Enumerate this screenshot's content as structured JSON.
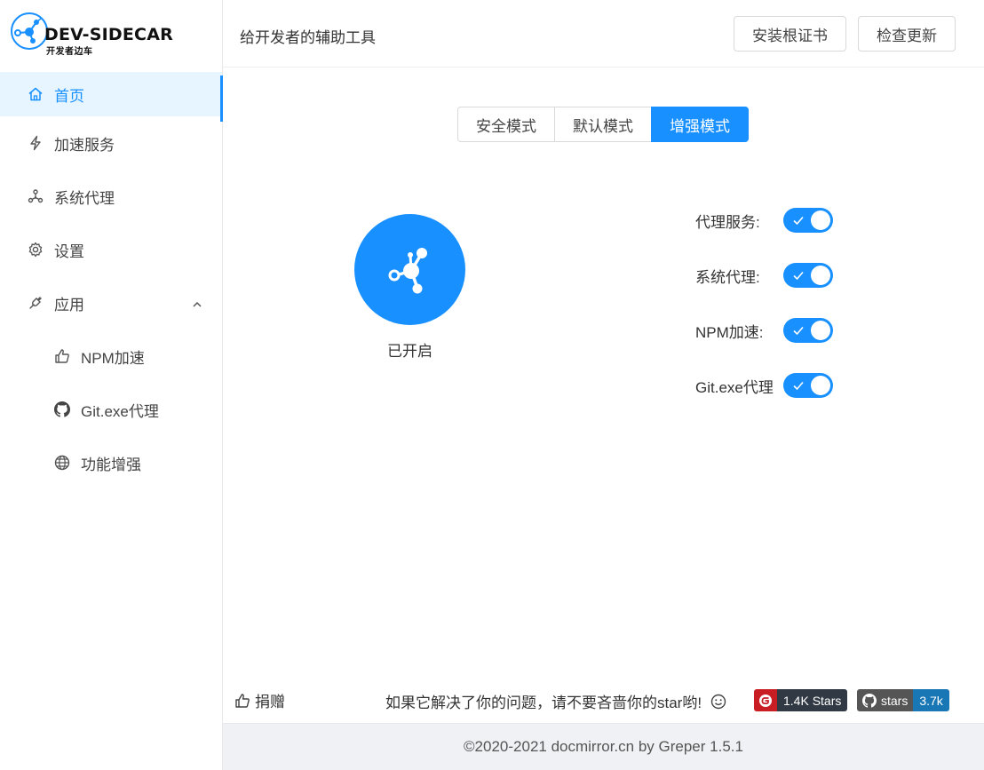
{
  "app": {
    "brand": "DEV-SIDECAR",
    "brand_sub": "开发者边车"
  },
  "header": {
    "title": "给开发者的辅助工具",
    "install_cert_label": "安装根证书",
    "check_update_label": "检查更新"
  },
  "sidebar": {
    "items": [
      {
        "label": "首页",
        "icon": "home-icon",
        "active": true
      },
      {
        "label": "加速服务",
        "icon": "lightning-icon"
      },
      {
        "label": "系统代理",
        "icon": "nodes-icon"
      },
      {
        "label": "设置",
        "icon": "gear-icon"
      },
      {
        "label": "应用",
        "icon": "plug-icon",
        "expanded": true
      }
    ],
    "sub_items": [
      {
        "label": "NPM加速",
        "icon": "thumbs-up-icon"
      },
      {
        "label": "Git.exe代理",
        "icon": "github-icon"
      },
      {
        "label": "功能增强",
        "icon": "globe-icon"
      }
    ]
  },
  "modes": {
    "options": [
      "安全模式",
      "默认模式",
      "增强模式"
    ],
    "selected": "增强模式"
  },
  "power": {
    "status": "已开启",
    "on": true
  },
  "switches": [
    {
      "label": "代理服务:",
      "on": true
    },
    {
      "label": "系统代理:",
      "on": true
    },
    {
      "label": "NPM加速:",
      "on": true
    },
    {
      "label": "Git.exe代理",
      "on": true
    }
  ],
  "footer": {
    "donate_label": "捐赠",
    "star_message": "如果它解决了你的问题，请不要吝啬你的star哟!",
    "gitee_badge": "1.4K Stars",
    "github_badge_label": "stars",
    "github_badge_count": "3.7k",
    "copyright": "©2020-2021 docmirror.cn by Greper 1.5.1"
  },
  "colors": {
    "accent": "#1890ff",
    "active_bg": "#e6f5ff",
    "gitee_red": "#c71d23",
    "badge_dark": "#313945",
    "github_blue": "#1a77b5"
  }
}
